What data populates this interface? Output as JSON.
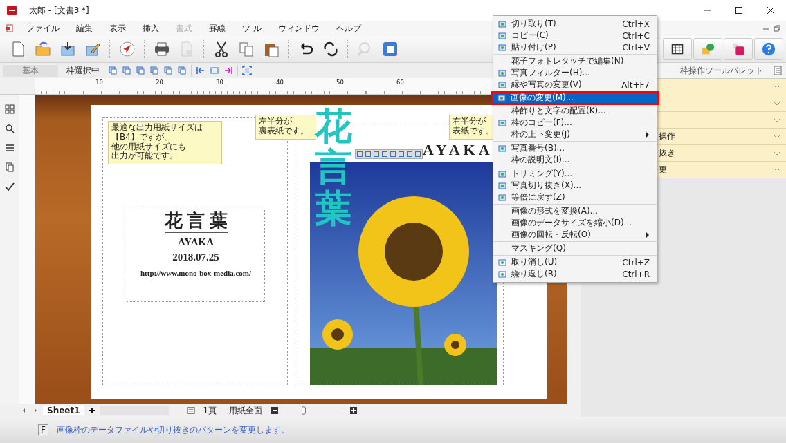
{
  "window": {
    "title": "一太郎 - [文書3 *]"
  },
  "menu_bar": [
    {
      "label": "ファイル",
      "disabled": false
    },
    {
      "label": "編集",
      "disabled": false
    },
    {
      "label": "表示",
      "disabled": false
    },
    {
      "label": "挿入",
      "disabled": false
    },
    {
      "label": "書式",
      "disabled": true
    },
    {
      "label": "罫線",
      "disabled": false
    },
    {
      "label": "ツ ル",
      "disabled": false
    },
    {
      "label": "ウィンドウ",
      "disabled": false
    },
    {
      "label": "ヘルプ",
      "disabled": false
    }
  ],
  "frame_toolbar": {
    "style_label": "基本",
    "mode_label": "枠選択中"
  },
  "ruler": {
    "ticks": [
      "10",
      "20",
      "30",
      "40",
      "50",
      "60"
    ]
  },
  "document": {
    "left_note": [
      "最適な出力用紙サイズは",
      "【B4】ですが、",
      "他の用紙サイズにも",
      "出力が可能です。"
    ],
    "title": "花 言 葉",
    "name": "AYAKA",
    "date": "2018.07.25",
    "url": "http://www.mono-box-media.com/",
    "back_note": [
      "左半分が",
      "裏表紙です。"
    ],
    "cover_title": "花言葉",
    "cover_name": "AYAKA",
    "front_note": [
      "右半分が",
      "表紙です。"
    ]
  },
  "context_menu": {
    "groups": [
      [
        {
          "label": "切り取り(T)",
          "shortcut": "Ctrl+X",
          "submenu": false,
          "selected": false
        },
        {
          "label": "コピー(C)",
          "shortcut": "Ctrl+C",
          "submenu": false,
          "selected": false
        },
        {
          "label": "貼り付け(P)",
          "shortcut": "Ctrl+V",
          "submenu": false,
          "selected": false
        }
      ],
      [
        {
          "label": "花子フォトレタッチで編集(N)",
          "submenu": false,
          "selected": false
        },
        {
          "label": "写真フィルター(H)...",
          "submenu": false,
          "selected": false
        },
        {
          "label": "縁や写真の変更(V)",
          "shortcut": "Alt+F7",
          "submenu": false,
          "selected": false
        },
        {
          "label": "画像の変更(M)...",
          "submenu": false,
          "selected": true
        },
        {
          "label": "枠飾りと文字の配置(K)...",
          "submenu": false,
          "selected": false
        },
        {
          "label": "枠のコピー(F)...",
          "submenu": false,
          "selected": false
        },
        {
          "label": "枠の上下変更(J)",
          "submenu": true,
          "selected": false
        }
      ],
      [
        {
          "label": "写真番号(B)...",
          "submenu": false,
          "selected": false
        },
        {
          "label": "枠の説明文(I)...",
          "submenu": false,
          "selected": false
        }
      ],
      [
        {
          "label": "トリミング(Y)...",
          "submenu": false,
          "selected": false
        },
        {
          "label": "写真切り抜き(X)...",
          "submenu": false,
          "selected": false
        },
        {
          "label": "等倍に戻す(Z)",
          "submenu": false,
          "selected": false
        }
      ],
      [
        {
          "label": "画像の形式を変換(A)...",
          "submenu": false,
          "selected": false
        },
        {
          "label": "画像のデータサイズを縮小(D)...",
          "submenu": false,
          "selected": false
        },
        {
          "label": "画像の回転・反転(O)",
          "submenu": true,
          "selected": false
        }
      ],
      [
        {
          "label": "マスキング(Q)",
          "submenu": false,
          "selected": false
        }
      ],
      [
        {
          "label": "取り消し(U)",
          "shortcut": "Ctrl+Z",
          "submenu": false,
          "selected": false
        },
        {
          "label": "繰り返し(R)",
          "shortcut": "Ctrl+R",
          "submenu": false,
          "selected": false
        }
      ]
    ]
  },
  "palette": {
    "title": "枠操作ツールパレット",
    "rows": [
      {},
      {},
      {},
      {
        "label": "操作"
      },
      {
        "label": "抜き"
      },
      {
        "label": "更"
      }
    ]
  },
  "sheet_tabs": [
    {
      "label": "Sheet1",
      "selected": true
    }
  ],
  "page_label": "1頁",
  "view_mode": "用紙全面",
  "zoom": {
    "level": 0.3
  },
  "status_bar": {
    "key": "F",
    "message": "画像枠のデータファイルや切り抜きのパターンを変更します。"
  }
}
